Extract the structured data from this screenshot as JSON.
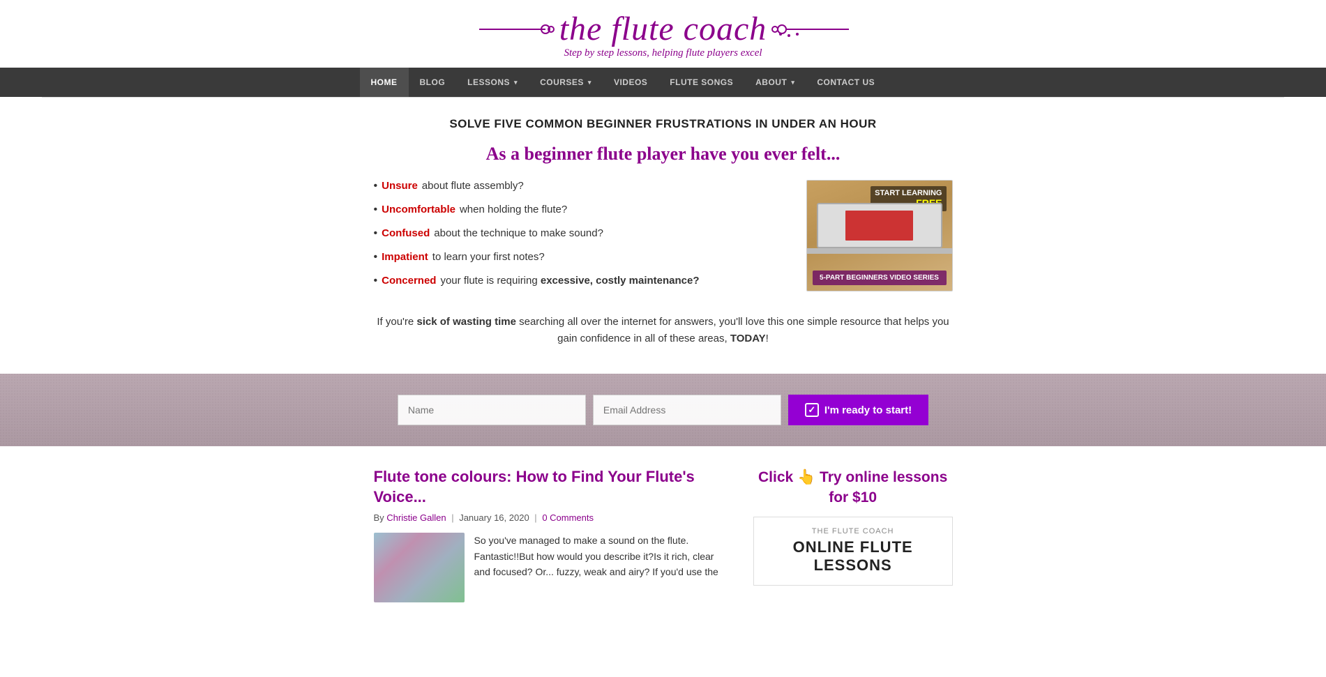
{
  "site": {
    "logo_text": "the flute coach",
    "logo_subtitle": "Step by step lessons, helping flute players excel"
  },
  "nav": {
    "items": [
      {
        "label": "HOME",
        "active": true,
        "has_arrow": false
      },
      {
        "label": "BLOG",
        "active": false,
        "has_arrow": false
      },
      {
        "label": "LESSONS",
        "active": false,
        "has_arrow": true
      },
      {
        "label": "COURSES",
        "active": false,
        "has_arrow": true
      },
      {
        "label": "VIDEOS",
        "active": false,
        "has_arrow": false
      },
      {
        "label": "FLUTE SONGS",
        "active": false,
        "has_arrow": false
      },
      {
        "label": "ABOUT",
        "active": false,
        "has_arrow": true
      },
      {
        "label": "CONTACT US",
        "active": false,
        "has_arrow": false
      }
    ]
  },
  "hero": {
    "headline": "SOLVE FIVE COMMON BEGINNER FRUSTRATIONS IN UNDER AN HOUR",
    "subheadline": "As a beginner flute player have you ever felt...",
    "bullets": [
      {
        "keyword": "Unsure",
        "rest": " about flute assembly?"
      },
      {
        "keyword": "Uncomfortable",
        "rest": " when holding the flute?"
      },
      {
        "keyword": "Confused",
        "rest": " about the technique to make sound?"
      },
      {
        "keyword": "Impatient",
        "rest": " to learn your first notes?"
      },
      {
        "keyword": "Concerned",
        "rest": " your flute is requiring ",
        "bold_part": "excessive, costly maintenance?",
        "has_bold": true
      }
    ],
    "ad_top": "START LEARNING",
    "ad_free": "FREE",
    "ad_bottom": "5-PART BEGINNERS VIDEO SERIES",
    "body_text_start": "If you're ",
    "body_text_bold": "sick of wasting time",
    "body_text_mid": " searching all over the internet for answers, you'll love this one simple resource that helps you gain confidence in all of these areas, ",
    "body_text_end_bold": "TODAY",
    "body_text_final": "!"
  },
  "cta": {
    "name_placeholder": "Name",
    "email_placeholder": "Email Address",
    "button_label": "I'm ready to start!"
  },
  "blog": {
    "post": {
      "title": "Flute tone colours: How to Find Your Flute's Voice...",
      "author": "Christie Gallen",
      "date": "January 16, 2020",
      "comments": "0 Comments",
      "by_label": "By",
      "excerpt": "So you've managed to make a sound on the flute. Fantastic!!But how would you describe it?Is it rich, clear and focused? Or... fuzzy, weak and airy? If you'd use the"
    }
  },
  "sidebar": {
    "cta_text": "Click 👆 Try online lessons for $10",
    "banner_label": "THE FLUTE COACH",
    "banner_title": "ONLINE FLUTE LESSONS"
  }
}
